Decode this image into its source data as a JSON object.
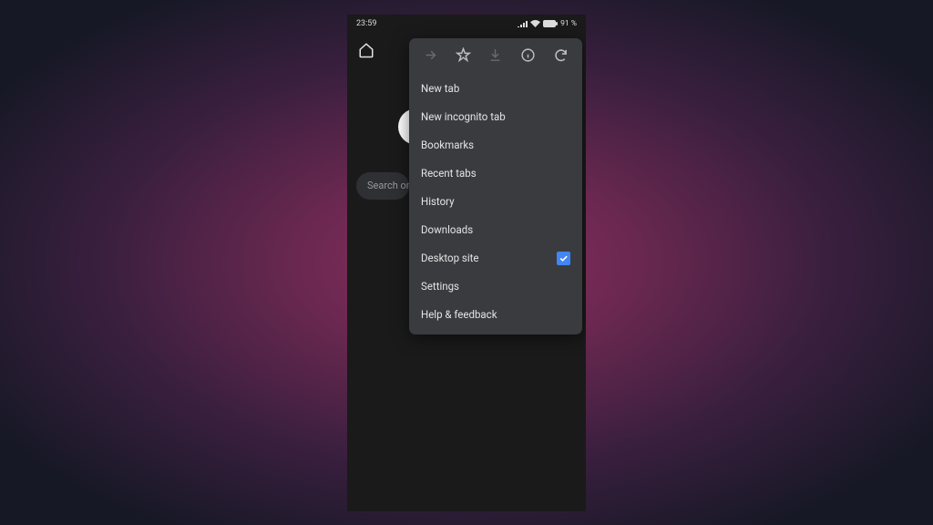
{
  "status": {
    "time": "23:59",
    "battery": "91 %"
  },
  "search": {
    "placeholder": "Search or"
  },
  "menu": {
    "items": [
      {
        "label": "New tab"
      },
      {
        "label": "New incognito tab"
      },
      {
        "label": "Bookmarks"
      },
      {
        "label": "Recent tabs"
      },
      {
        "label": "History"
      },
      {
        "label": "Downloads"
      },
      {
        "label": "Desktop site",
        "checked": true
      },
      {
        "label": "Settings"
      },
      {
        "label": "Help & feedback"
      }
    ]
  }
}
